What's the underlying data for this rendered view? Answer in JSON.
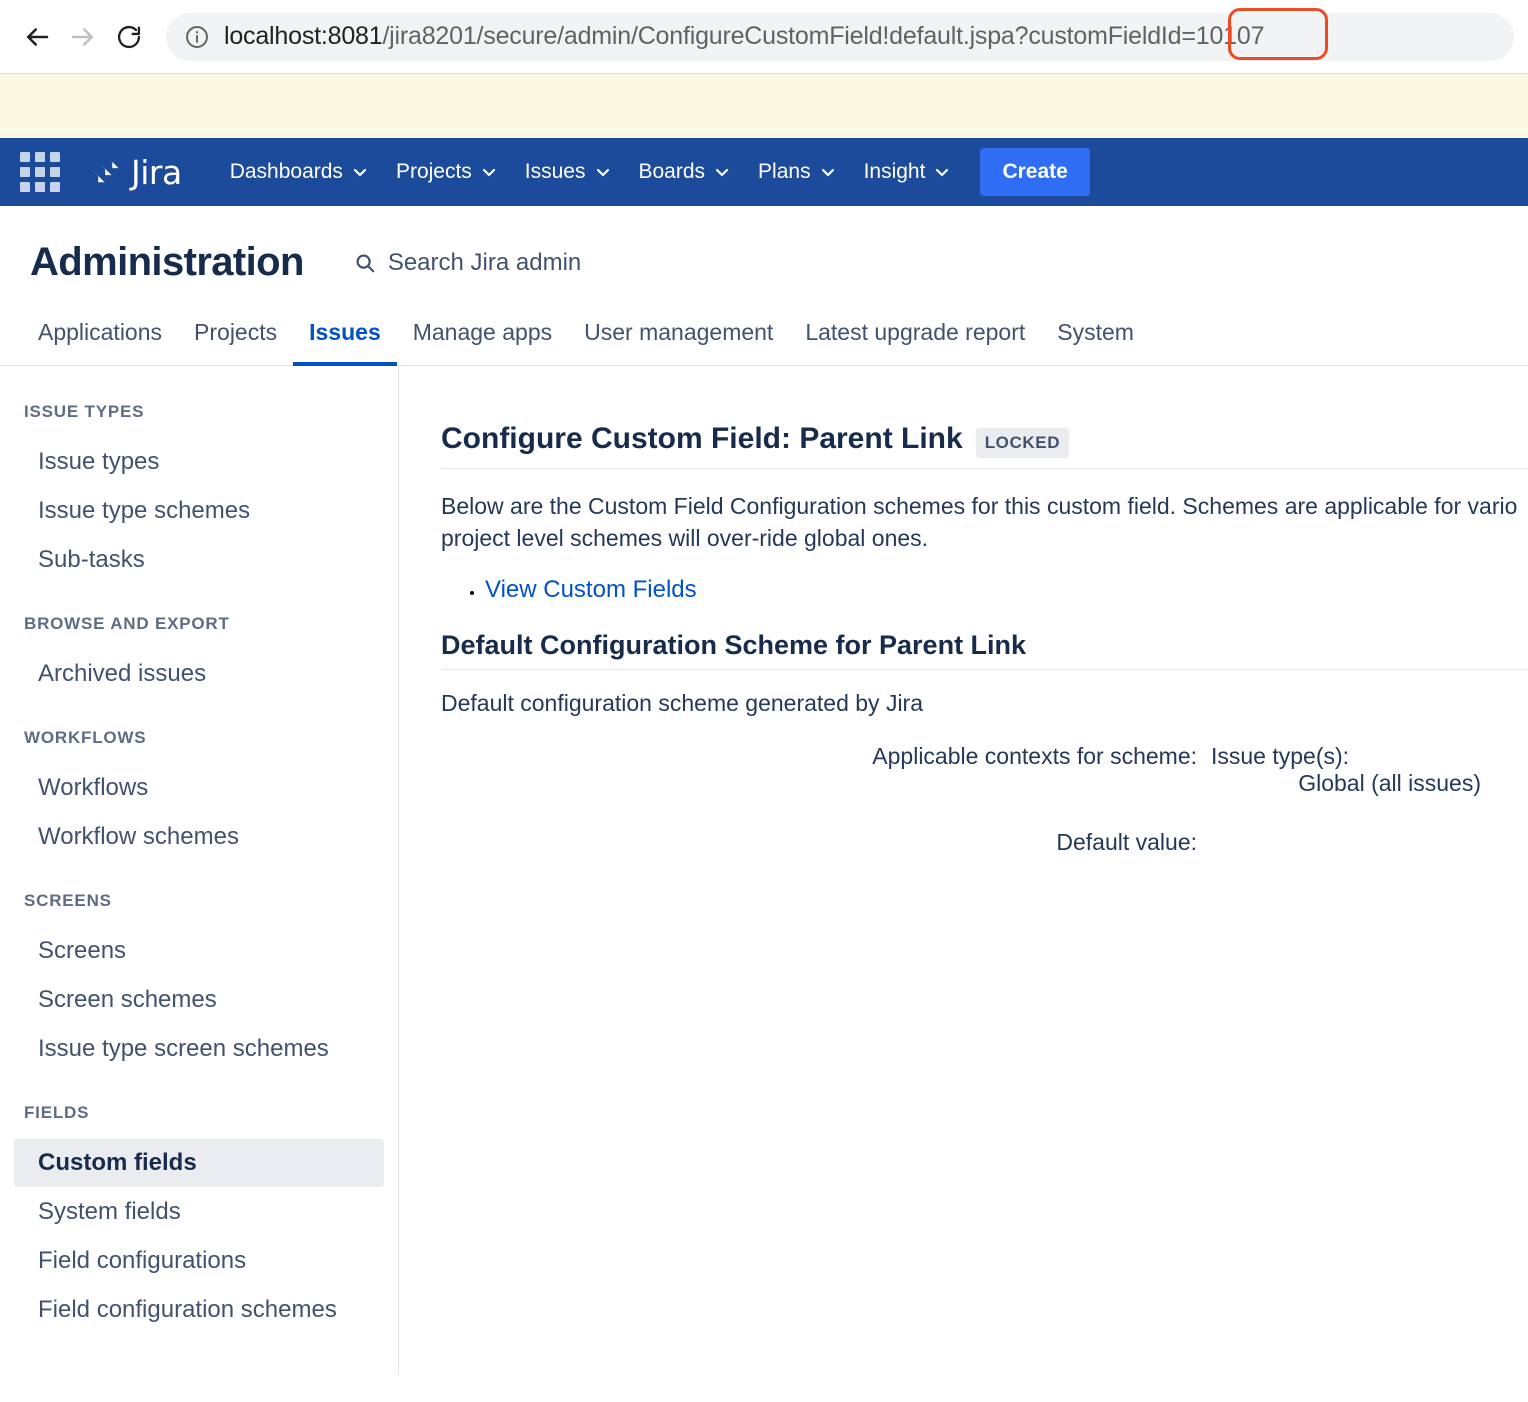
{
  "browser": {
    "back_icon": "arrow-left-icon",
    "forward_icon": "arrow-right-icon",
    "reload_icon": "reload-icon",
    "info_icon": "info-circle-icon",
    "url_host": "localhost:8081",
    "url_path": "/jira8201/secure/admin/ConfigureCustomField!default.jspa?customFieldId=10107",
    "url_full": "localhost:8081/jira8201/secure/admin/ConfigureCustomField!default.jspa?customFieldId=10107",
    "annotation": "10107"
  },
  "topnav": {
    "app_switcher_icon": "grid-apps-icon",
    "logo_text": "Jira",
    "items": [
      {
        "label": "Dashboards",
        "has_chevron": true
      },
      {
        "label": "Projects",
        "has_chevron": true
      },
      {
        "label": "Issues",
        "has_chevron": true
      },
      {
        "label": "Boards",
        "has_chevron": true
      },
      {
        "label": "Plans",
        "has_chevron": true
      },
      {
        "label": "Insight",
        "has_chevron": true
      }
    ],
    "create_label": "Create",
    "bg_color": "#1C4B9B",
    "create_color": "#2F6EF4"
  },
  "admin": {
    "title": "Administration",
    "search_placeholder": "Search Jira admin",
    "search_icon": "search-icon",
    "tabs": [
      {
        "label": "Applications",
        "active": false
      },
      {
        "label": "Projects",
        "active": false
      },
      {
        "label": "Issues",
        "active": true
      },
      {
        "label": "Manage apps",
        "active": false
      },
      {
        "label": "User management",
        "active": false
      },
      {
        "label": "Latest upgrade report",
        "active": false
      },
      {
        "label": "System",
        "active": false
      }
    ],
    "active_tab_color": "#0052CC"
  },
  "sidebar": {
    "sections": [
      {
        "heading": "ISSUE TYPES",
        "items": [
          {
            "label": "Issue types",
            "selected": false
          },
          {
            "label": "Issue type schemes",
            "selected": false
          },
          {
            "label": "Sub-tasks",
            "selected": false
          }
        ]
      },
      {
        "heading": "BROWSE AND EXPORT",
        "items": [
          {
            "label": "Archived issues",
            "selected": false
          }
        ]
      },
      {
        "heading": "WORKFLOWS",
        "items": [
          {
            "label": "Workflows",
            "selected": false
          },
          {
            "label": "Workflow schemes",
            "selected": false
          }
        ]
      },
      {
        "heading": "SCREENS",
        "items": [
          {
            "label": "Screens",
            "selected": false
          },
          {
            "label": "Screen schemes",
            "selected": false
          },
          {
            "label": "Issue type screen schemes",
            "selected": false
          }
        ]
      },
      {
        "heading": "FIELDS",
        "items": [
          {
            "label": "Custom fields",
            "selected": true
          },
          {
            "label": "System fields",
            "selected": false
          },
          {
            "label": "Field configurations",
            "selected": false
          },
          {
            "label": "Field configuration schemes",
            "selected": false
          }
        ]
      }
    ],
    "selected_bg": "#EBECF0"
  },
  "content": {
    "title": "Configure Custom Field: Parent Link",
    "badge": "LOCKED",
    "description_line1": "Below are the Custom Field Configuration schemes for this custom field. Schemes are applicable for vario",
    "description_line2": "project level schemes will over-ride global ones.",
    "link_label": "View Custom Fields",
    "scheme_title": "Default Configuration Scheme for Parent Link",
    "scheme_description": "Default configuration scheme generated by Jira",
    "properties": [
      {
        "label": "Applicable contexts for scheme:",
        "value_line1": "Issue type(s):",
        "value_line2": "Global (all issues)"
      },
      {
        "label": "Default value:",
        "value_line1": "",
        "value_line2": ""
      }
    ],
    "link_color": "#0052CC"
  }
}
